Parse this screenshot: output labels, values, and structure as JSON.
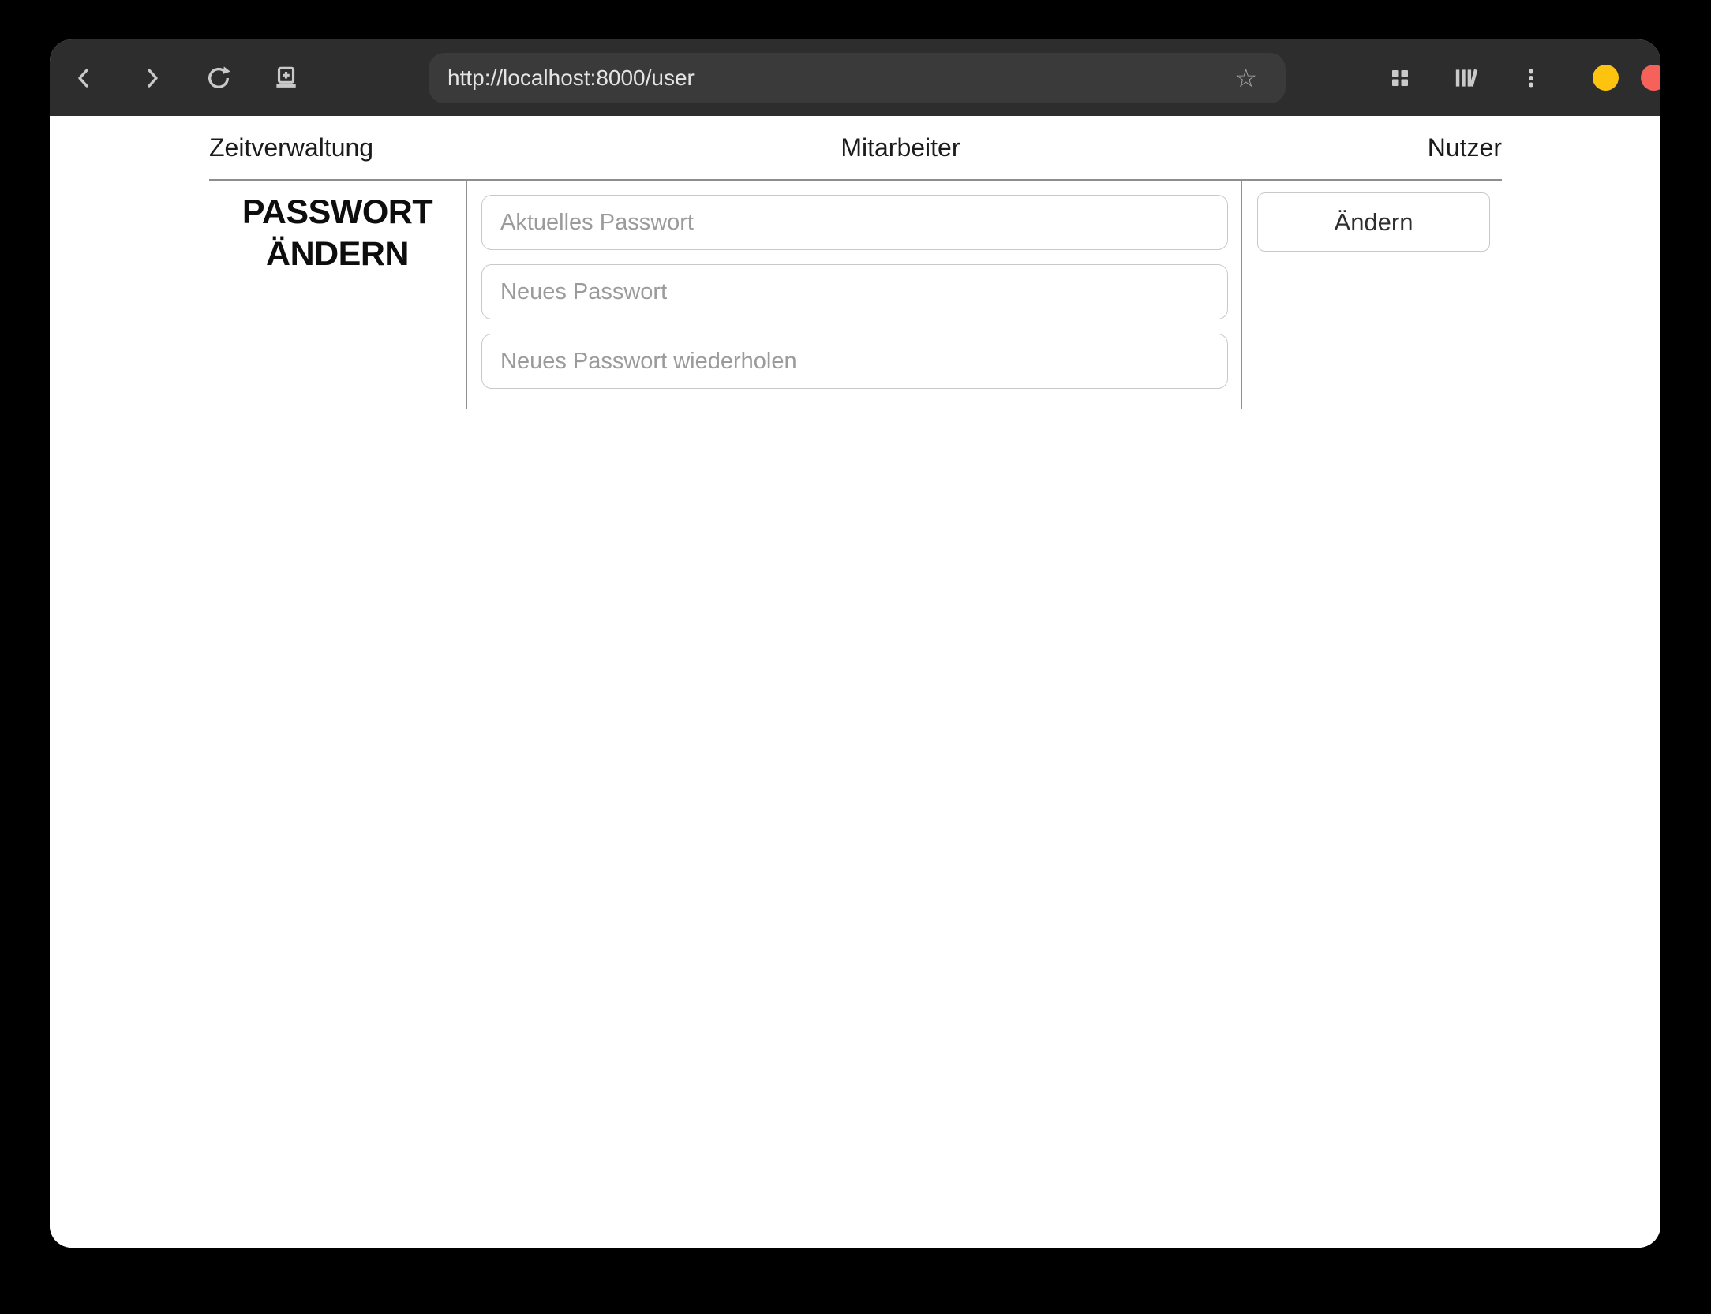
{
  "browser": {
    "url": "http://localhost:8000/user",
    "star_glyph": "☆",
    "icons": {
      "back": "chevron-left",
      "forward": "chevron-right",
      "reload": "circular-arrow",
      "new_tab": "window-plus",
      "bookmark": "star-outline",
      "tab_overview": "grid-squares",
      "library": "books-shelf",
      "menu": "kebab-dots"
    },
    "window_controls": {
      "minimize_color": "#fdc30f",
      "close_color": "#f6615a"
    }
  },
  "nav": {
    "items": [
      {
        "label": "Zeitverwaltung"
      },
      {
        "label": "Mitarbeiter"
      },
      {
        "label": "Nutzer"
      }
    ]
  },
  "password_form": {
    "heading": "PASSWORT ÄNDERN",
    "fields": [
      {
        "placeholder": "Aktuelles Passwort",
        "value": ""
      },
      {
        "placeholder": "Neues Passwort",
        "value": ""
      },
      {
        "placeholder": "Neues Passwort wiederholen",
        "value": ""
      }
    ],
    "submit_label": "Ändern"
  },
  "colors": {
    "titlebar_bg": "#2d2d2d",
    "urlbar_bg": "#3a3a3a",
    "page_bg": "#ffffff",
    "divider": "#8e8e8e",
    "input_border": "#c9c9c9",
    "placeholder_text": "#9b9b9b"
  }
}
